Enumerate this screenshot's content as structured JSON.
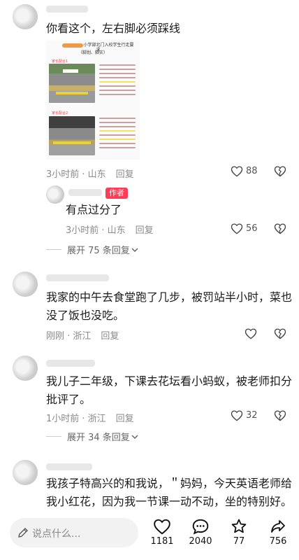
{
  "comments": [
    {
      "text": "你看这个，左右脚必须踩线",
      "time_loc": "3小时前 · 山东",
      "reply": "回复",
      "likes": "88"
    },
    {
      "author_badge": "作者",
      "text": "有点过分了",
      "time_loc": "3小时前 · 山东",
      "reply": "回复",
      "likes": "56",
      "expand": "展开 75 条回复"
    },
    {
      "text_line1": "我家的中午去食堂跑了几步，被罚站半小时，菜也",
      "text_line2": "没了饭也没吃。",
      "time_loc": "刚刚 · 浙江",
      "reply": "回复"
    },
    {
      "text_line1": "我儿子二年级，下课去花坛看小蚂蚁，被老师扣分",
      "text_line2": "批评了。",
      "time_loc": "1小时前 · 浙江",
      "reply": "回复",
      "likes": "32",
      "expand": "展开 34 条回复"
    },
    {
      "text_line1": "我孩子特高兴的和我说，＂妈妈，今天英语老师给",
      "text_line2": "我小红花，因为我一节课一动不动，坐的特别好。"
    }
  ],
  "embedded_image": {
    "title": "小学部北门入校学生行走要求",
    "subtitle": "（脚划、脚实）",
    "label1": "家长配合1",
    "label2": "家长配合2"
  },
  "bottom_bar": {
    "input_placeholder": "说点什么...",
    "likes": "1181",
    "comments": "2040",
    "favorites": "77",
    "shares": "756"
  },
  "icons": [
    "heart-icon",
    "broken-heart-icon",
    "chevron-down-icon",
    "pencil-icon",
    "comment-bubble-icon",
    "star-icon",
    "share-icon"
  ],
  "colors": {
    "author_badge": "#ff3b56",
    "meta": "#8a8a8a",
    "text": "#1a1a1a"
  }
}
